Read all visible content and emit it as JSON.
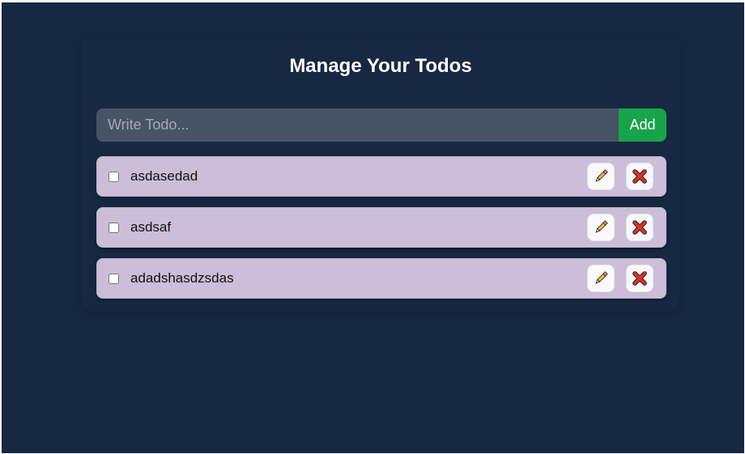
{
  "page": {
    "title": "Manage Your Todos"
  },
  "form": {
    "placeholder": "Write Todo...",
    "value": "",
    "add_label": "Add"
  },
  "todos": [
    {
      "text": "asdasedad",
      "completed": false
    },
    {
      "text": "asdsaf",
      "completed": false
    },
    {
      "text": "adadshasdzsdas",
      "completed": false
    }
  ],
  "icons": {
    "edit": "pencil-icon",
    "delete": "cross-mark-icon"
  },
  "colors": {
    "background": "#172842",
    "input": "#465466",
    "add_button": "#17a34a",
    "todo_item": "#ccbed8",
    "action_button": "#f9f8fb"
  }
}
